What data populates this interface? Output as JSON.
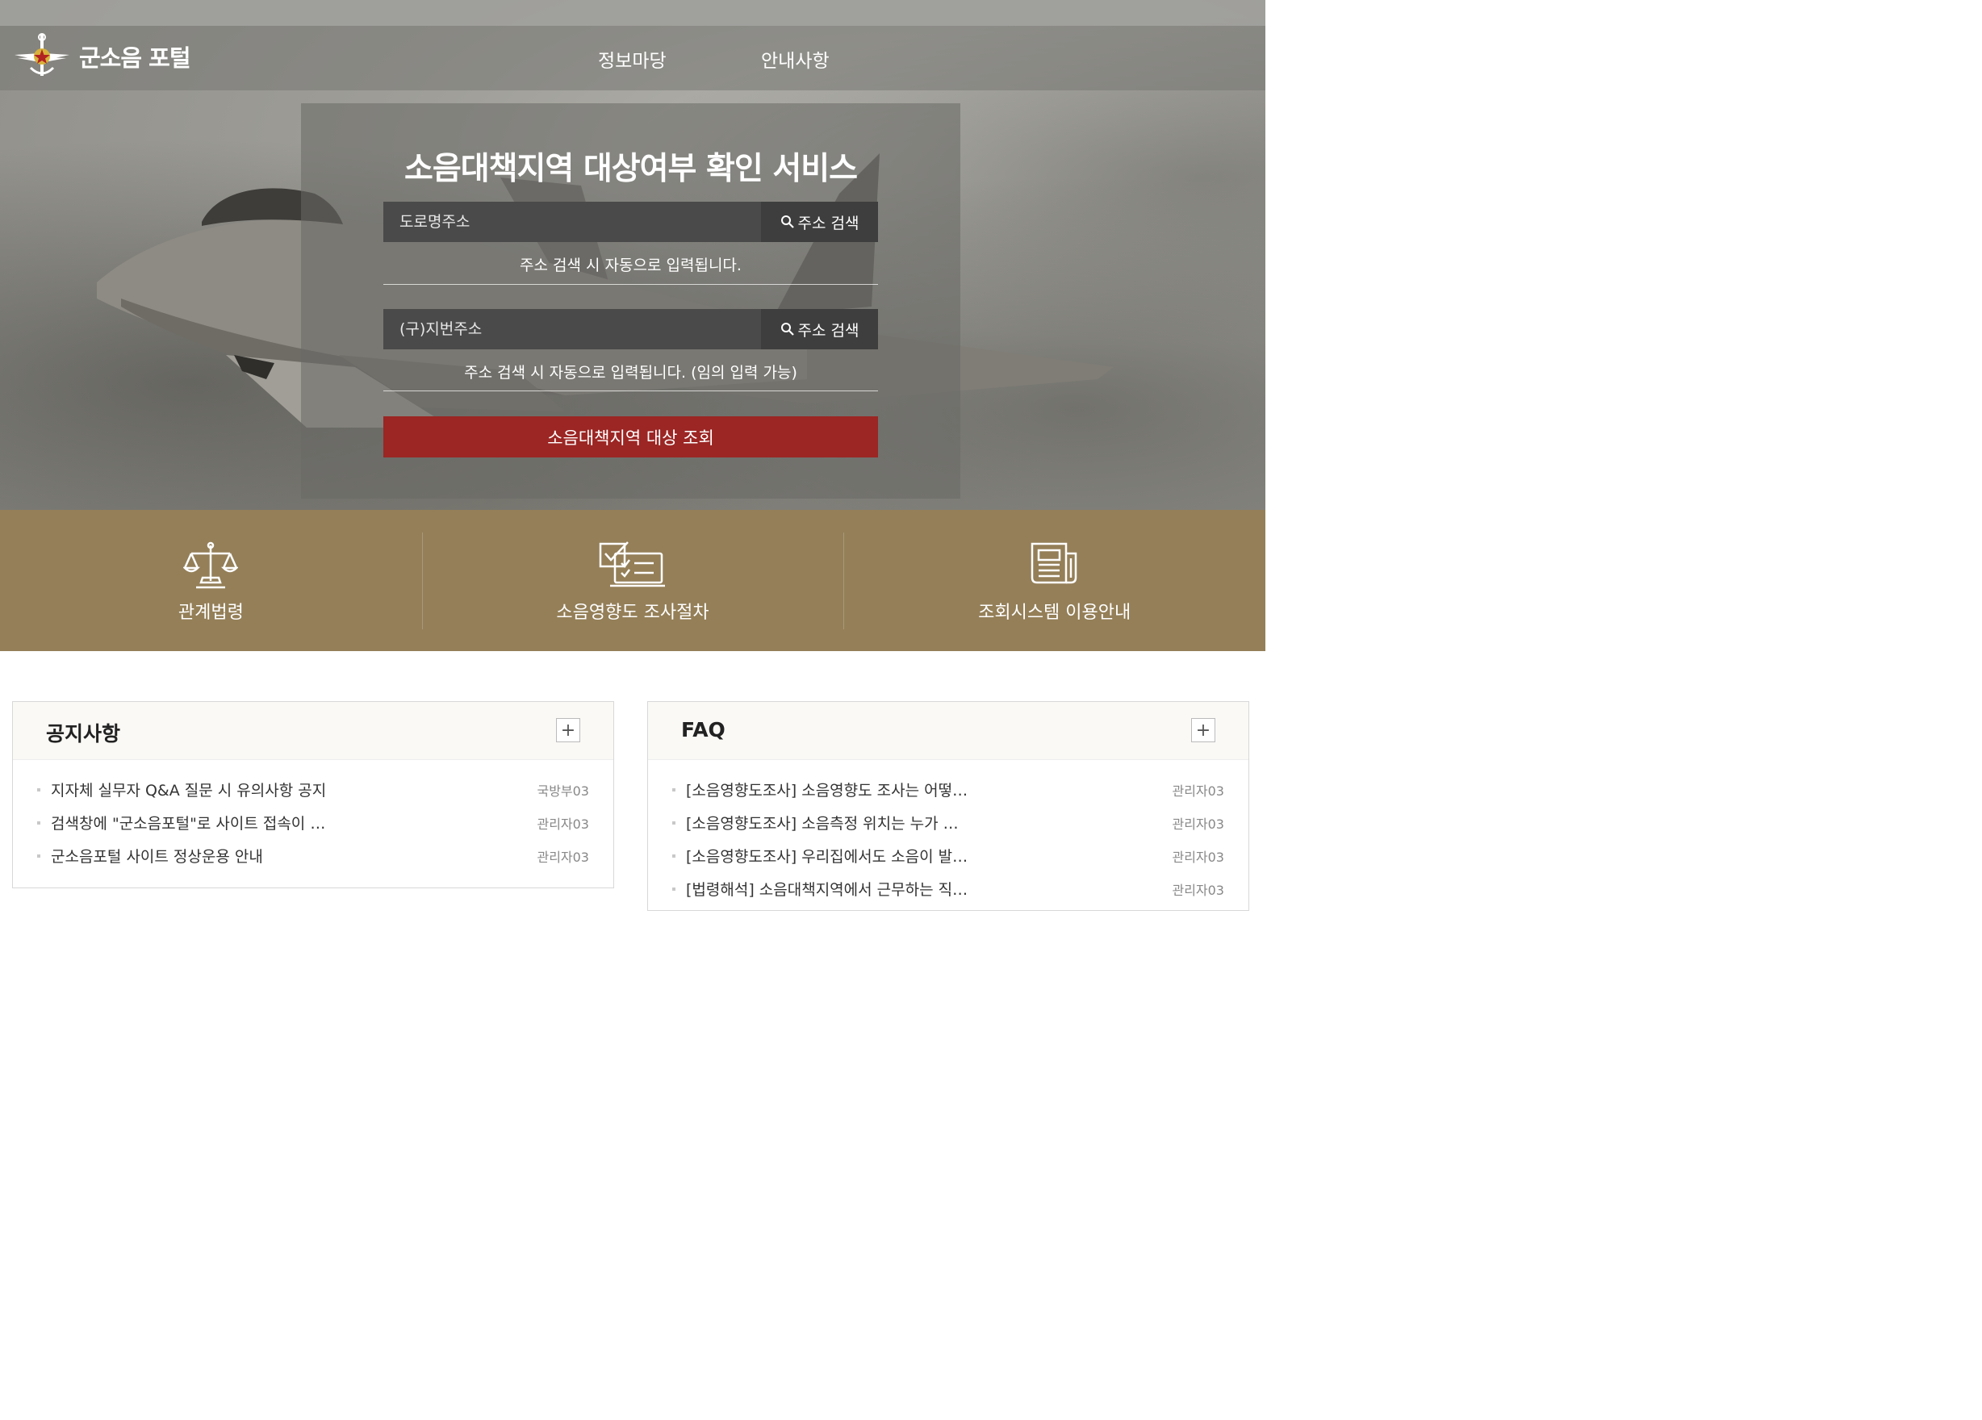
{
  "header": {
    "logo_text": "군소음 포털",
    "nav": [
      "정보마당",
      "안내사항"
    ]
  },
  "search": {
    "title": "소음대책지역 대상여부 확인 서비스",
    "road_address": {
      "placeholder": "도로명주소",
      "button_label": "주소 검색",
      "hint": "주소 검색 시 자동으로 입력됩니다."
    },
    "lot_address": {
      "placeholder": "(구)지번주소",
      "button_label": "주소 검색",
      "hint": "주소 검색 시 자동으로 입력됩니다. (임의 입력 가능)"
    },
    "submit_label": "소음대책지역 대상 조회"
  },
  "quick_links": [
    {
      "label": "관계법령",
      "icon": "scales-icon"
    },
    {
      "label": "소음영향도 조사절차",
      "icon": "checklist-icon"
    },
    {
      "label": "조회시스템 이용안내",
      "icon": "newspaper-icon"
    }
  ],
  "notices": {
    "title": "공지사항",
    "more": "+",
    "items": [
      {
        "title": "지자체 실무자 Q&A 질문 시 유의사항 공지",
        "author": "국방부03"
      },
      {
        "title": "검색창에 \"군소음포털\"로 사이트 접속이 …",
        "author": "관리자03"
      },
      {
        "title": "군소음포털 사이트 정상운용 안내",
        "author": "관리자03"
      }
    ]
  },
  "faq": {
    "title": "FAQ",
    "more": "+",
    "items": [
      {
        "title": "[소음영향도조사] 소음영향도 조사는 어떻…",
        "author": "관리자03"
      },
      {
        "title": "[소음영향도조사] 소음측정 위치는 누가 …",
        "author": "관리자03"
      },
      {
        "title": "[소음영향도조사] 우리집에서도 소음이 발…",
        "author": "관리자03"
      },
      {
        "title": "[법령해석] 소음대책지역에서 근무하는 직…",
        "author": "관리자03"
      }
    ]
  },
  "colors": {
    "accent_red": "#9b2624",
    "quick_bar": "#947f58"
  }
}
